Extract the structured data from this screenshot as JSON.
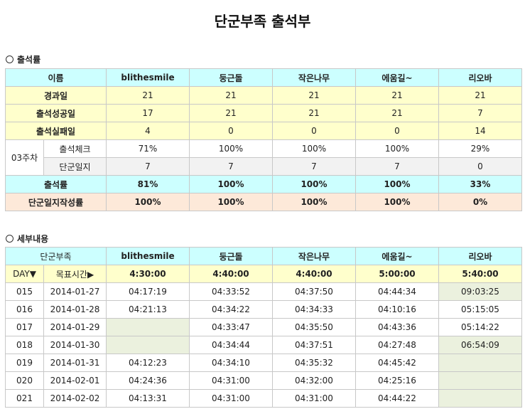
{
  "title": "단군부족 출석부",
  "summary": {
    "section_title": "출석률",
    "header_label": "이름",
    "members": [
      "blithesmile",
      "둥근돌",
      "작은나무",
      "에움길~",
      "리오바"
    ],
    "rows": {
      "elapsed": {
        "label": "경과일",
        "values": [
          "21",
          "21",
          "21",
          "21",
          "21"
        ]
      },
      "success": {
        "label": "출석성공일",
        "values": [
          "17",
          "21",
          "21",
          "21",
          "7"
        ]
      },
      "fail": {
        "label": "출석실패일",
        "values": [
          "4",
          "0",
          "0",
          "0",
          "14"
        ]
      }
    },
    "week_label": "03주차",
    "week_rows": {
      "check": {
        "label": "출석체크",
        "values": [
          "71%",
          "100%",
          "100%",
          "100%",
          "29%"
        ]
      },
      "journal": {
        "label": "단군일지",
        "values": [
          "7",
          "7",
          "7",
          "7",
          "0"
        ]
      }
    },
    "rate": {
      "label": "출석률",
      "values": [
        "81%",
        "100%",
        "100%",
        "100%",
        "33%"
      ]
    },
    "write_rate": {
      "label": "단군일지작성률",
      "values": [
        "100%",
        "100%",
        "100%",
        "100%",
        "0%"
      ]
    }
  },
  "detail": {
    "section_title": "세부내용",
    "header_label": "단군부족",
    "members": [
      "blithesmile",
      "둥근돌",
      "작은나무",
      "에움길~",
      "리오바"
    ],
    "day_label": "DAY▼",
    "target_label": "목표시간▶",
    "targets": [
      "4:30:00",
      "4:40:00",
      "4:40:00",
      "5:00:00",
      "5:40:00"
    ],
    "rows": [
      {
        "day": "015",
        "date": "2014-01-27",
        "times": [
          "04:17:19",
          "04:33:52",
          "04:37:50",
          "04:44:34",
          "09:03:25"
        ]
      },
      {
        "day": "016",
        "date": "2014-01-28",
        "times": [
          "04:21:13",
          "04:34:22",
          "04:34:33",
          "04:10:16",
          "05:15:05"
        ]
      },
      {
        "day": "017",
        "date": "2014-01-29",
        "times": [
          "",
          "04:33:47",
          "04:35:50",
          "04:43:36",
          "05:14:22"
        ]
      },
      {
        "day": "018",
        "date": "2014-01-30",
        "times": [
          "",
          "04:34:44",
          "04:37:51",
          "04:27:48",
          "06:54:09"
        ]
      },
      {
        "day": "019",
        "date": "2014-01-31",
        "times": [
          "04:12:23",
          "04:34:10",
          "04:35:32",
          "04:45:42",
          ""
        ]
      },
      {
        "day": "020",
        "date": "2014-02-01",
        "times": [
          "04:24:36",
          "04:31:00",
          "04:32:00",
          "04:25:16",
          ""
        ]
      },
      {
        "day": "021",
        "date": "2014-02-02",
        "times": [
          "04:13:31",
          "04:31:00",
          "04:31:00",
          "04:44:22",
          ""
        ]
      }
    ]
  }
}
